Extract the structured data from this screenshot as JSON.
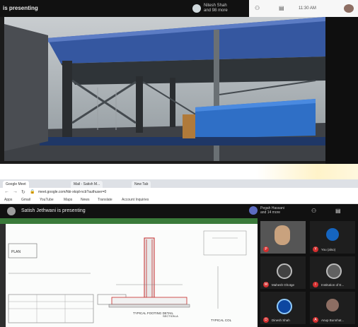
{
  "top_meeting": {
    "presenting_text": "is presenting",
    "presenter_name": "Nitesh Shah",
    "presenter_sub": "and 98 more",
    "time": "11:30 AM"
  },
  "browser": {
    "tabs": [
      "Google Meet",
      "Mail - Satish M...",
      "New Tab"
    ],
    "url": "meet.google.com/hbi-xkqd-ncb?authuser=0",
    "bookmarks": [
      "Apps",
      "Gmail",
      "YouTube",
      "Maps",
      "News",
      "Translate",
      "Account Inquiries"
    ]
  },
  "bottom_meeting": {
    "presenting_text": "Satish Jethwani is presenting",
    "participant_name": "Pegah Hassani",
    "participant_sub": "and 14 more",
    "tiles": [
      {
        "label": "",
        "badge": "P"
      },
      {
        "label": "You (also)",
        "badge": "Y"
      },
      {
        "label": "Mahesh Ghotge",
        "badge": "M"
      },
      {
        "label": "Institution of E...",
        "badge": "I"
      },
      {
        "label": "Dinesh Shah",
        "badge": "D"
      },
      {
        "label": "Anup Bunnhat...",
        "badge": "A"
      }
    ]
  },
  "drawing": {
    "labels": [
      "SECTION-A",
      "TYPICAL FOOTING DETAIL",
      "PLAN",
      "TYPICAL COL"
    ]
  }
}
